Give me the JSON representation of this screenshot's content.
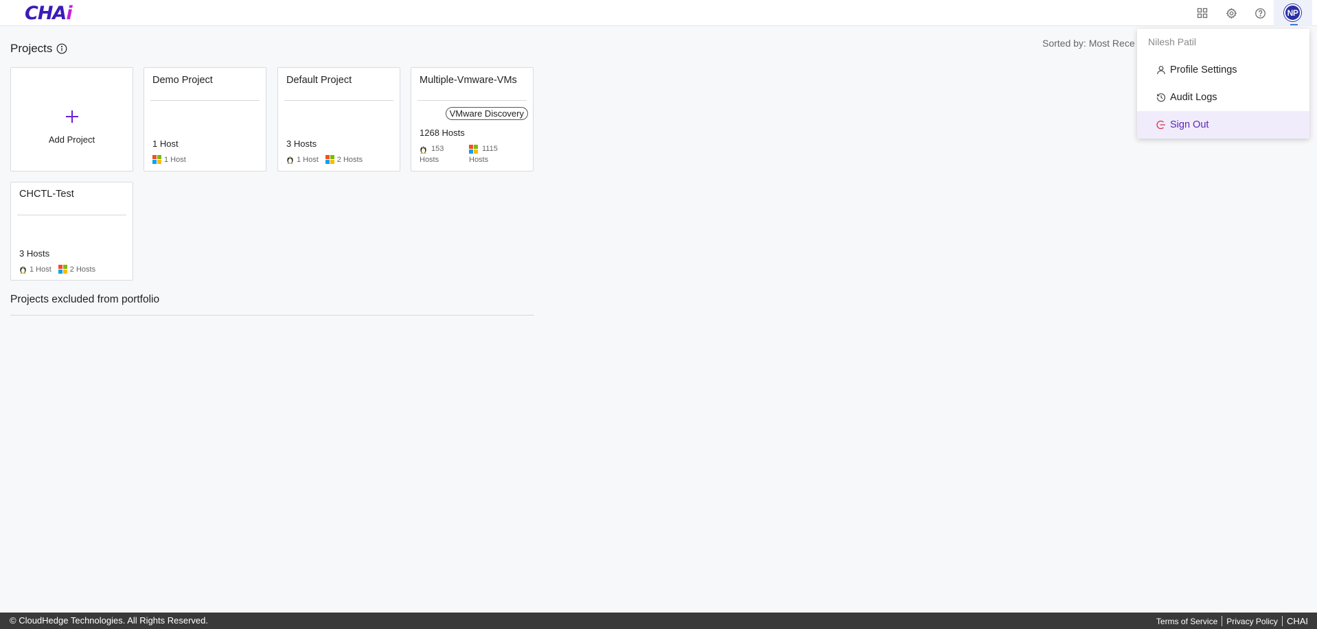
{
  "header": {
    "logo_left": "CHA",
    "logo_accent": "i",
    "avatar_initials": "NP",
    "icons": [
      "apps-grid-icon",
      "gear-icon",
      "help-icon"
    ]
  },
  "page": {
    "title": "Projects",
    "sorted_by": "Sorted by: Most Rece"
  },
  "add_project": {
    "label": "Add Project"
  },
  "projects": [
    {
      "name": "Demo Project",
      "hosts": "1 Host",
      "windows": "1 Host"
    },
    {
      "name": "Default Project",
      "hosts": "3 Hosts",
      "linux": "1 Host",
      "windows": "2 Hosts"
    },
    {
      "name": "Multiple-Vmware-VMs",
      "badge": "VMware Discovery",
      "hosts": "1268 Hosts",
      "linux_count": "153",
      "linux_unit": "Hosts",
      "windows_count": "1115",
      "windows_unit": "Hosts"
    },
    {
      "name": "CHCTL-Test",
      "hosts": "3 Hosts",
      "linux": "1 Host",
      "windows": "2 Hosts"
    }
  ],
  "excluded": {
    "title": "Projects excluded from portfolio"
  },
  "user_menu": {
    "user_name": "Nilesh Patil",
    "items": [
      {
        "label": "Profile Settings",
        "icon": "user-icon"
      },
      {
        "label": "Audit Logs",
        "icon": "history-icon"
      },
      {
        "label": "Sign Out",
        "icon": "sign-out-icon"
      }
    ]
  },
  "footer": {
    "copyright": "© CloudHedge Technologies. All Rights Reserved.",
    "terms": "Terms of Service",
    "privacy": "Privacy Policy",
    "brand": "CHAI"
  },
  "colors": {
    "brand": "#3c1bb8",
    "brand_accent": "#c21fd6",
    "avatar": "#2a2fa6",
    "menu_active_bg": "#f1ecfb",
    "menu_active_text": "#5a26b8",
    "sign_out_icon": "#d6324a",
    "footer_bg": "#3a3a3a"
  }
}
